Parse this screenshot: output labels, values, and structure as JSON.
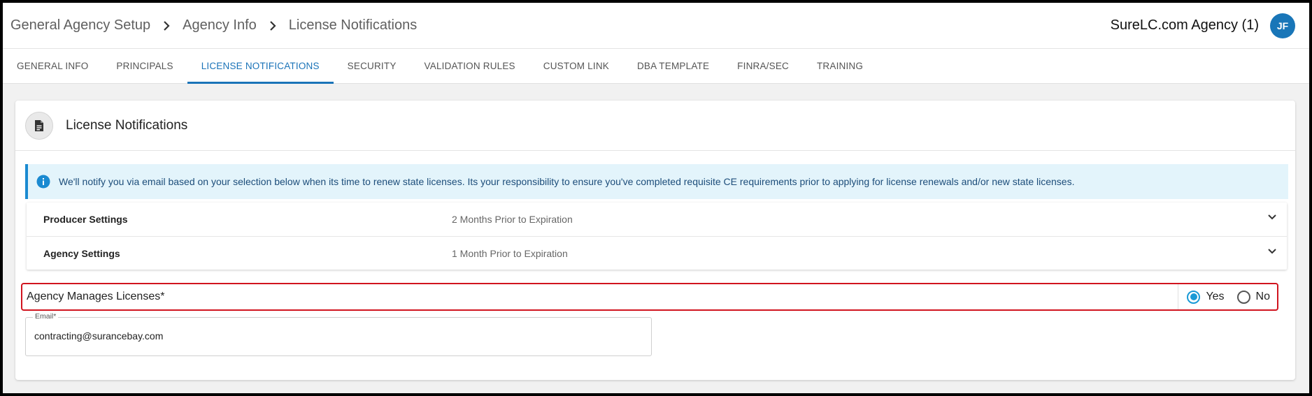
{
  "header": {
    "breadcrumb": [
      "General Agency Setup",
      "Agency Info",
      "License Notifications"
    ],
    "agency_name": "SureLC.com Agency (1)",
    "avatar_initials": "JF"
  },
  "tabs": [
    {
      "label": "GENERAL INFO",
      "active": false
    },
    {
      "label": "PRINCIPALS",
      "active": false
    },
    {
      "label": "LICENSE NOTIFICATIONS",
      "active": true
    },
    {
      "label": "SECURITY",
      "active": false
    },
    {
      "label": "VALIDATION RULES",
      "active": false
    },
    {
      "label": "CUSTOM LINK",
      "active": false
    },
    {
      "label": "DBA TEMPLATE",
      "active": false
    },
    {
      "label": "FINRA/SEC",
      "active": false
    },
    {
      "label": "TRAINING",
      "active": false
    }
  ],
  "card": {
    "title": "License Notifications",
    "icon": "document-icon",
    "info_message": "We'll notify you via email based on your selection below when its time to renew state licenses. Its your responsibility to ensure you've completed requisite CE requirements prior to applying for license renewals and/or new state licenses.",
    "settings": [
      {
        "label": "Producer Settings",
        "value": "2 Months Prior to Expiration"
      },
      {
        "label": "Agency Settings",
        "value": "1 Month Prior to Expiration"
      }
    ],
    "agency_manages": {
      "label": "Agency Manages Licenses*",
      "options": [
        "Yes",
        "No"
      ],
      "selected": "Yes"
    },
    "email": {
      "label": "Email*",
      "value": "contracting@surancebay.com"
    }
  },
  "colors": {
    "accent": "#1a73b8",
    "radio_selected": "#1a9ad6",
    "highlight_border": "#d1141f",
    "info_bg": "#e3f4fb"
  }
}
